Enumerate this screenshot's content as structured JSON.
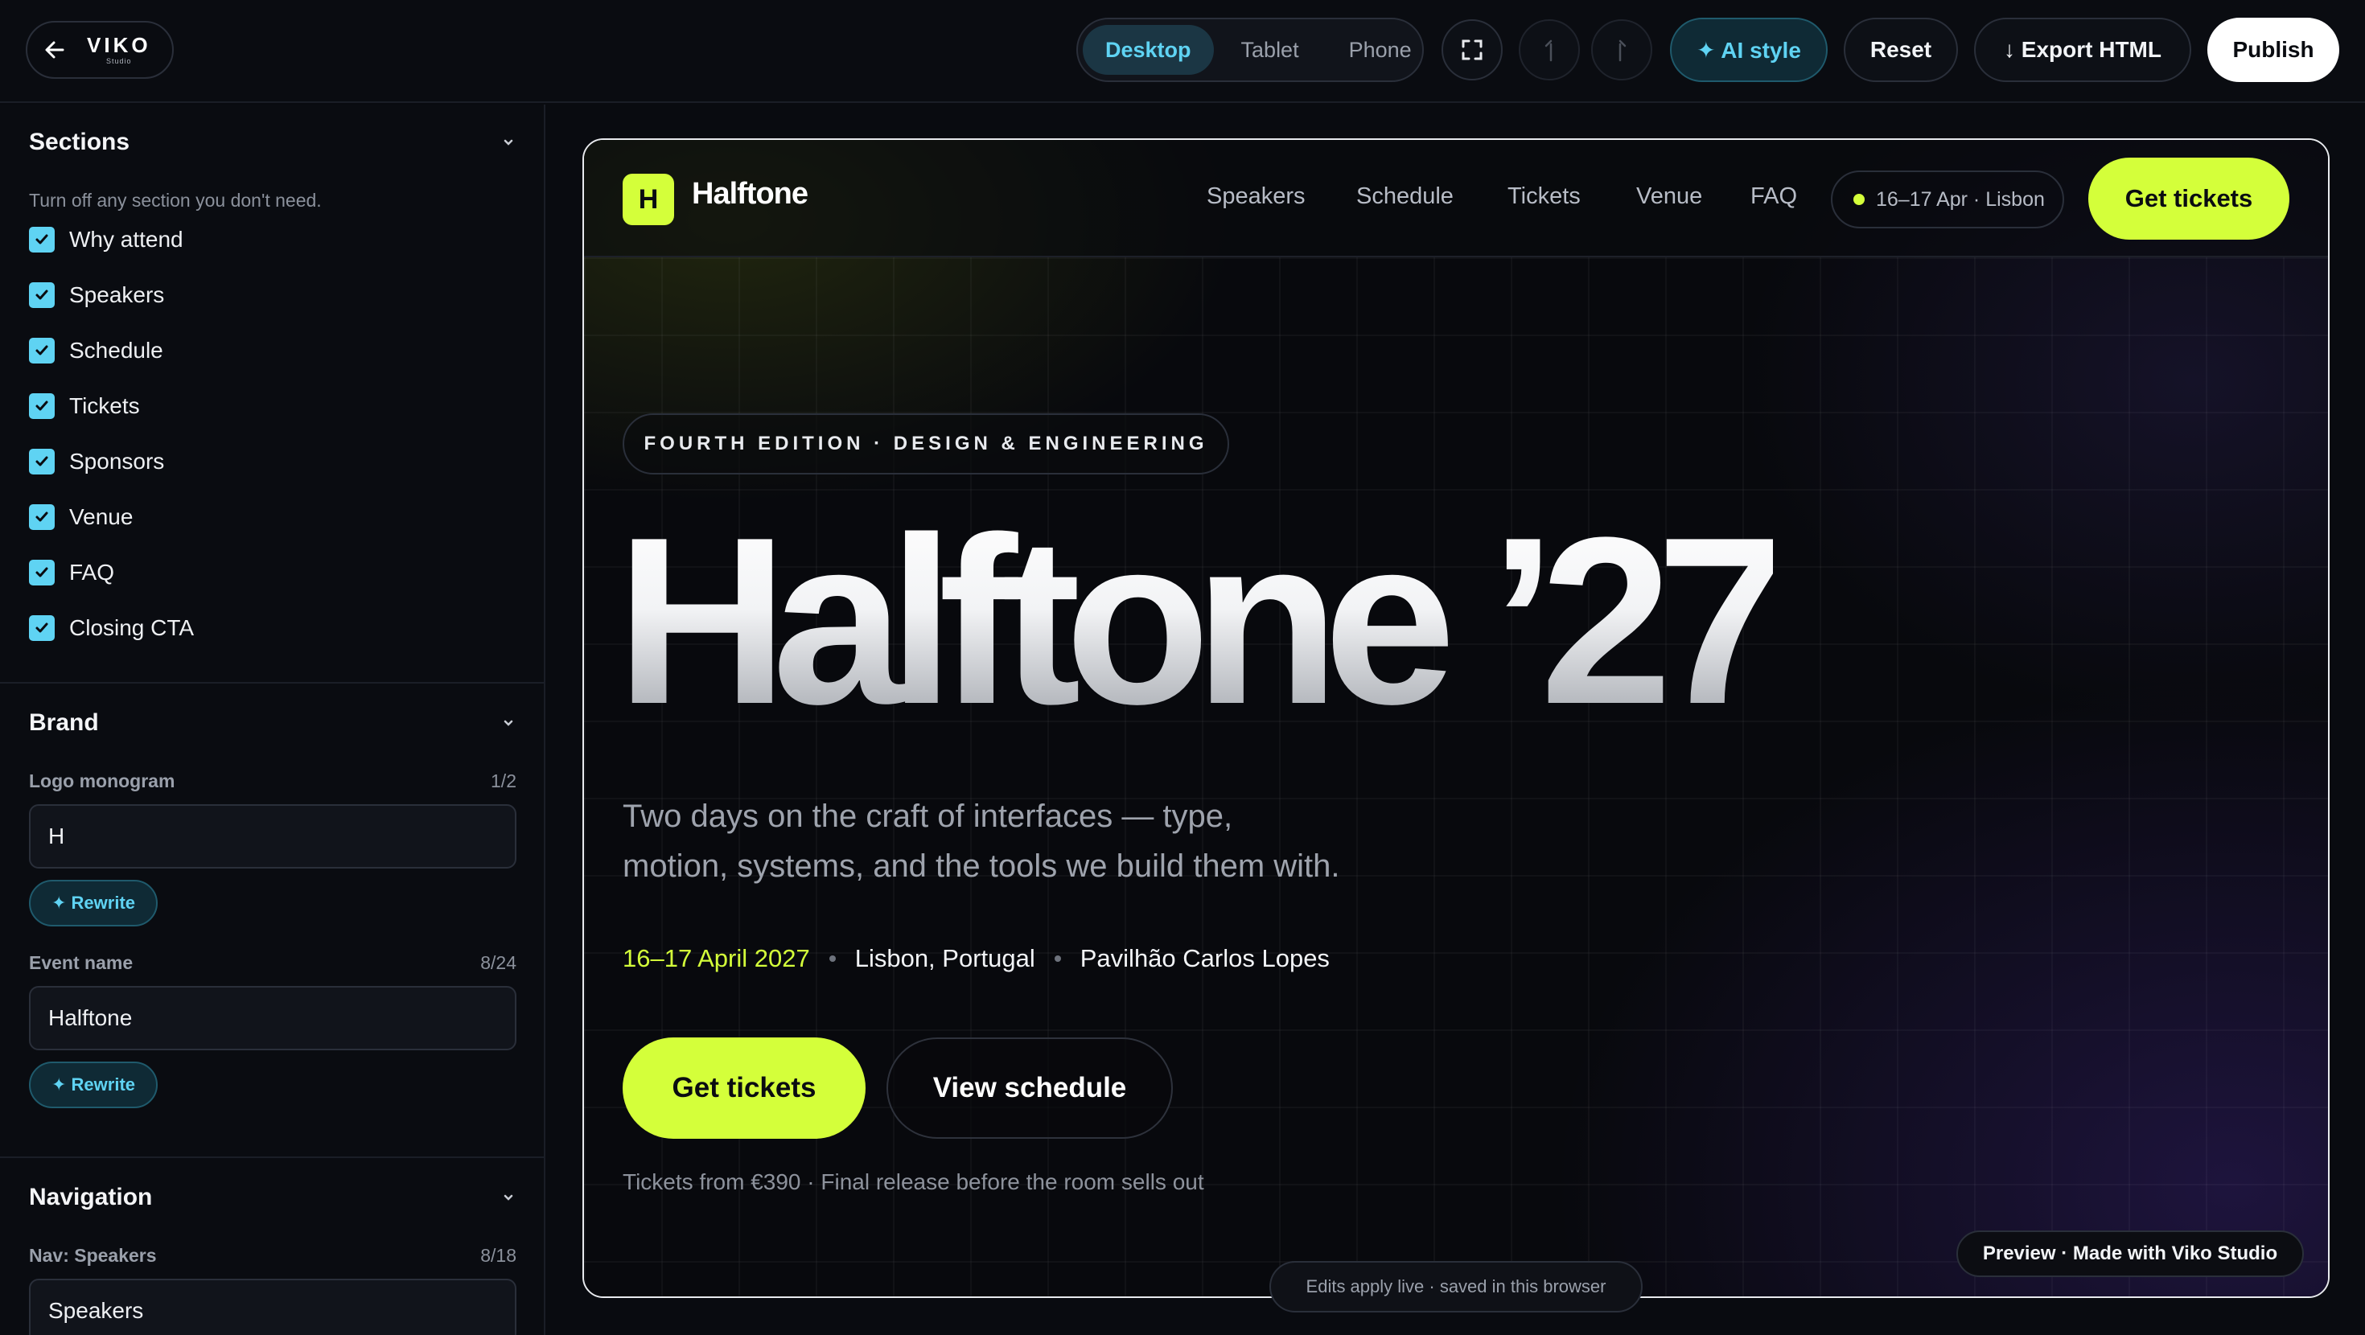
{
  "app": {
    "brand_name": "VIKO",
    "brand_sub": "Studio"
  },
  "toolbar": {
    "devices": [
      "Desktop",
      "Tablet",
      "Phone"
    ],
    "active_device": "Desktop",
    "ai_style_label": "✦ AI style",
    "reset_label": "Reset",
    "export_label": "↓ Export HTML",
    "publish_label": "Publish"
  },
  "sidebar": {
    "sections": {
      "title": "Sections",
      "hint": "Turn off any section you don't need.",
      "items": [
        {
          "label": "Why attend",
          "checked": true
        },
        {
          "label": "Speakers",
          "checked": true
        },
        {
          "label": "Schedule",
          "checked": true
        },
        {
          "label": "Tickets",
          "checked": true
        },
        {
          "label": "Sponsors",
          "checked": true
        },
        {
          "label": "Venue",
          "checked": true
        },
        {
          "label": "FAQ",
          "checked": true
        },
        {
          "label": "Closing CTA",
          "checked": true
        }
      ]
    },
    "brand": {
      "title": "Brand",
      "logo_label": "Logo monogram",
      "logo_count": "1/2",
      "logo_value": "H",
      "event_label": "Event name",
      "event_count": "8/24",
      "event_value": "Halftone",
      "rewrite_label": "✦ Rewrite"
    },
    "navigation": {
      "title": "Navigation",
      "nav_speakers_label": "Nav: Speakers",
      "nav_speakers_count": "8/18",
      "nav_speakers_value": "Speakers"
    }
  },
  "preview": {
    "logo_mark": "H",
    "logo_name": "Halftone",
    "nav_links": [
      "Speakers",
      "Schedule",
      "Tickets",
      "Venue",
      "FAQ"
    ],
    "date_pill": "16–17 Apr · Lisbon",
    "nav_cta": "Get tickets",
    "eyebrow": "FOURTH EDITION · DESIGN & ENGINEERING",
    "hero_title": "Halftone ’27",
    "hero_sub": "Two days on the craft of interfaces — type, motion, systems, and the tools we build them with.",
    "meta_date": "16–17 April 2027",
    "meta_city": "Lisbon, Portugal",
    "meta_venue": "Pavilhão Carlos Lopes",
    "cta_primary": "Get tickets",
    "cta_secondary": "View schedule",
    "ticket_note": "Tickets from €390 · Final release before the room sells out",
    "made_with": "Preview · Made with Viko Studio"
  },
  "status": {
    "toast": "Edits apply live · saved in this browser"
  },
  "colors": {
    "accent_cyan": "#5fd3f3",
    "accent_lime": "#d4ff3a",
    "background": "#090b10"
  }
}
